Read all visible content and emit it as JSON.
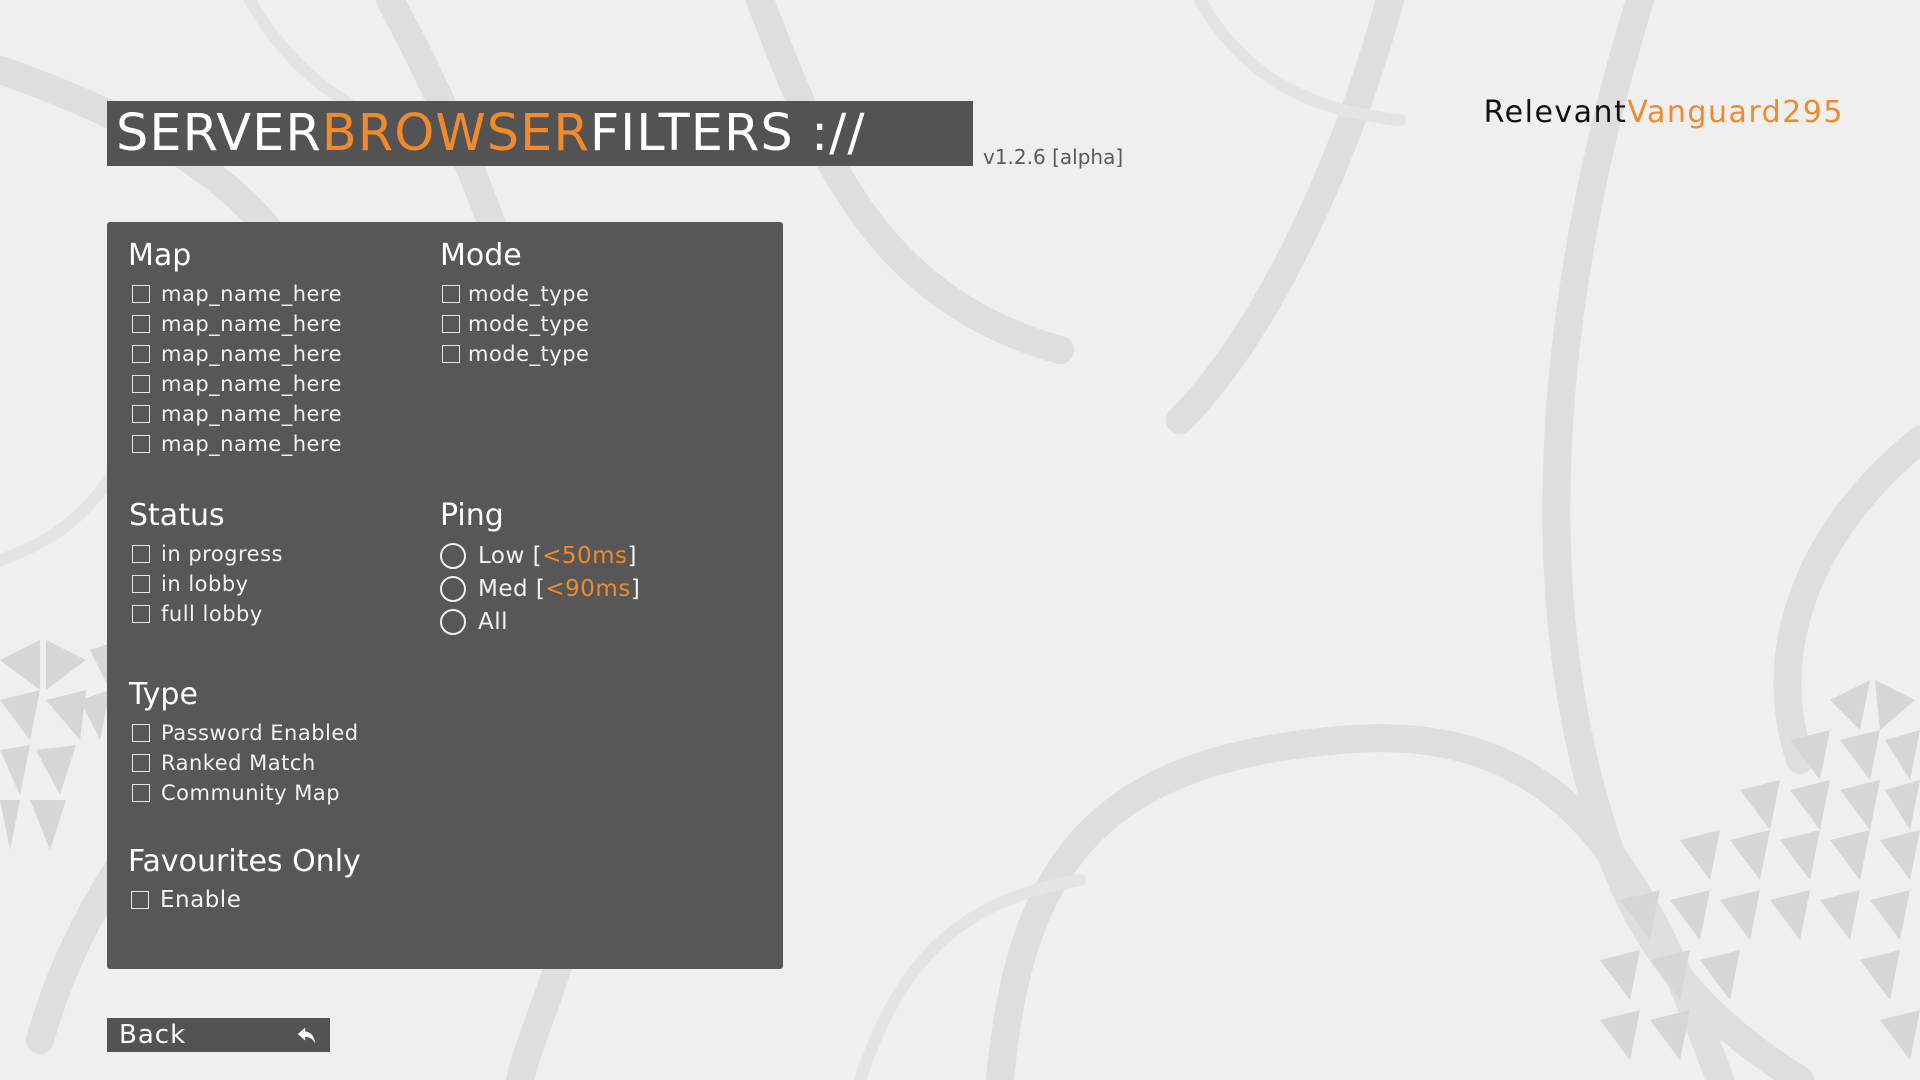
{
  "header": {
    "title_part1": "SERVER ",
    "title_part2": "BROWSER",
    "title_part3": " FILTERS ://",
    "version": "v1.2.6 [alpha]",
    "username_part1": "Relevant",
    "username_part2": "Vanguard295"
  },
  "colors": {
    "accent": "#f08a2a",
    "panel": "#575757",
    "background": "#efefef"
  },
  "filters": {
    "map": {
      "title": "Map",
      "options": [
        "map_name_here",
        "map_name_here",
        "map_name_here",
        "map_name_here",
        "map_name_here",
        "map_name_here"
      ]
    },
    "mode": {
      "title": "Mode",
      "options": [
        "mode_type",
        "mode_type",
        "mode_type"
      ]
    },
    "status": {
      "title": "Status",
      "options": [
        "in progress",
        "in lobby",
        "full lobby"
      ]
    },
    "ping": {
      "title": "Ping",
      "options": [
        {
          "label": "Low [",
          "ms": "<50ms",
          "end": "]"
        },
        {
          "label": "Med [",
          "ms": "<90ms",
          "end": "]"
        },
        {
          "label": "All",
          "ms": "",
          "end": ""
        }
      ]
    },
    "type": {
      "title": "Type",
      "options": [
        "Password Enabled",
        "Ranked Match",
        "Community Map"
      ]
    },
    "favourites": {
      "title": "Favourites Only",
      "option": "Enable"
    }
  },
  "footer": {
    "back_label": "Back",
    "back_icon": "back-arrow-icon"
  }
}
